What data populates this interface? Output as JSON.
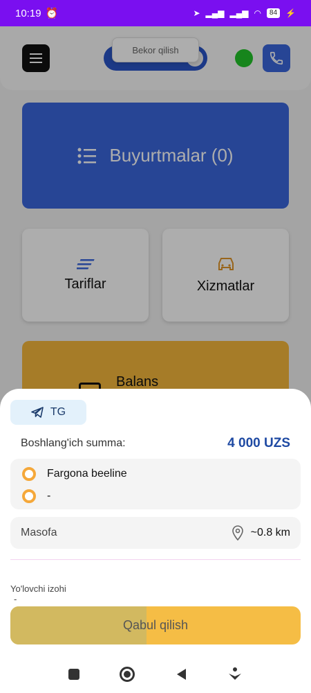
{
  "status_bar": {
    "time": "10:19",
    "battery": "84"
  },
  "header": {
    "toggle_tooltip": "Bekor qilish"
  },
  "dashboard": {
    "orders_label": "Buyurtmalar (0)",
    "tariffs_label": "Tariflar",
    "services_label": "Xizmatlar",
    "balance_label": "Balans"
  },
  "order": {
    "source_chip": "TG",
    "start_sum_label": "Boshlang'ich summa:",
    "start_sum_value": "4 000 UZS",
    "pickup": "Fargona beeline",
    "destination": "-",
    "distance_label": "Masofa",
    "distance_value": "~0.8 km",
    "note_label": "Yo'lovchi izohi",
    "note_value": "-",
    "accept_label": "Qabul qilish",
    "accept_progress": 0.47
  },
  "colors": {
    "accent_blue": "#3a66dc",
    "accent_orange": "#f5b73b",
    "status_purple": "#7a0ff0"
  }
}
